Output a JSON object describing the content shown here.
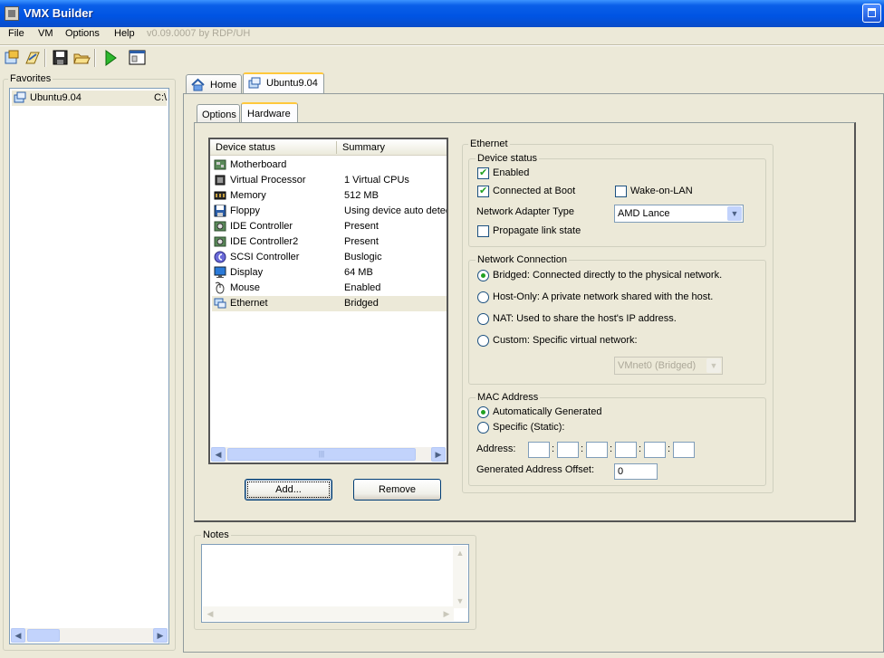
{
  "window": {
    "title": "VMX Builder"
  },
  "menu": {
    "items": [
      "File",
      "VM",
      "Options",
      "Help"
    ],
    "version": "v0.09.0007 by RDP/UH"
  },
  "favorites": {
    "title": "Favorites",
    "items": [
      {
        "label": "Ubuntu9.04",
        "path": "C:\\"
      }
    ]
  },
  "tabs": {
    "main": [
      "Home",
      "Ubuntu9.04"
    ],
    "sub": [
      "Options",
      "Hardware"
    ]
  },
  "devices": {
    "columns": [
      "Device status",
      "Summary"
    ],
    "rows": [
      {
        "name": "Motherboard",
        "summary": ""
      },
      {
        "name": "Virtual Processor",
        "summary": "1 Virtual CPUs"
      },
      {
        "name": "Memory",
        "summary": "512 MB"
      },
      {
        "name": "Floppy",
        "summary": "Using device auto detect"
      },
      {
        "name": "IDE Controller",
        "summary": "Present"
      },
      {
        "name": "IDE Controller2",
        "summary": "Present"
      },
      {
        "name": "SCSI Controller",
        "summary": "Buslogic"
      },
      {
        "name": "Display",
        "summary": "64 MB"
      },
      {
        "name": "Mouse",
        "summary": "Enabled"
      },
      {
        "name": "Ethernet",
        "summary": "Bridged"
      }
    ],
    "selected": "Ethernet",
    "add_label": "Add...",
    "remove_label": "Remove"
  },
  "ethernet": {
    "title": "Ethernet",
    "device_status": {
      "title": "Device status",
      "enabled": "Enabled",
      "connected": "Connected at Boot",
      "wol": "Wake-on-LAN",
      "adapter_label": "Network Adapter Type",
      "adapter_value": "AMD Lance",
      "propagate": "Propagate link state"
    },
    "connection": {
      "title": "Network Connection",
      "options": [
        "Bridged: Connected directly to the physical network.",
        "Host-Only: A private network shared with the host.",
        "NAT: Used to share the host's IP address.",
        "Custom: Specific virtual network:"
      ],
      "custom_value": "VMnet0 (Bridged)"
    },
    "mac": {
      "title": "MAC Address",
      "auto": "Automatically Generated",
      "specific": "Specific (Static):",
      "address_label": "Address:",
      "offset_label": "Generated Address Offset:",
      "offset_value": "0"
    }
  },
  "notes": {
    "title": "Notes"
  }
}
